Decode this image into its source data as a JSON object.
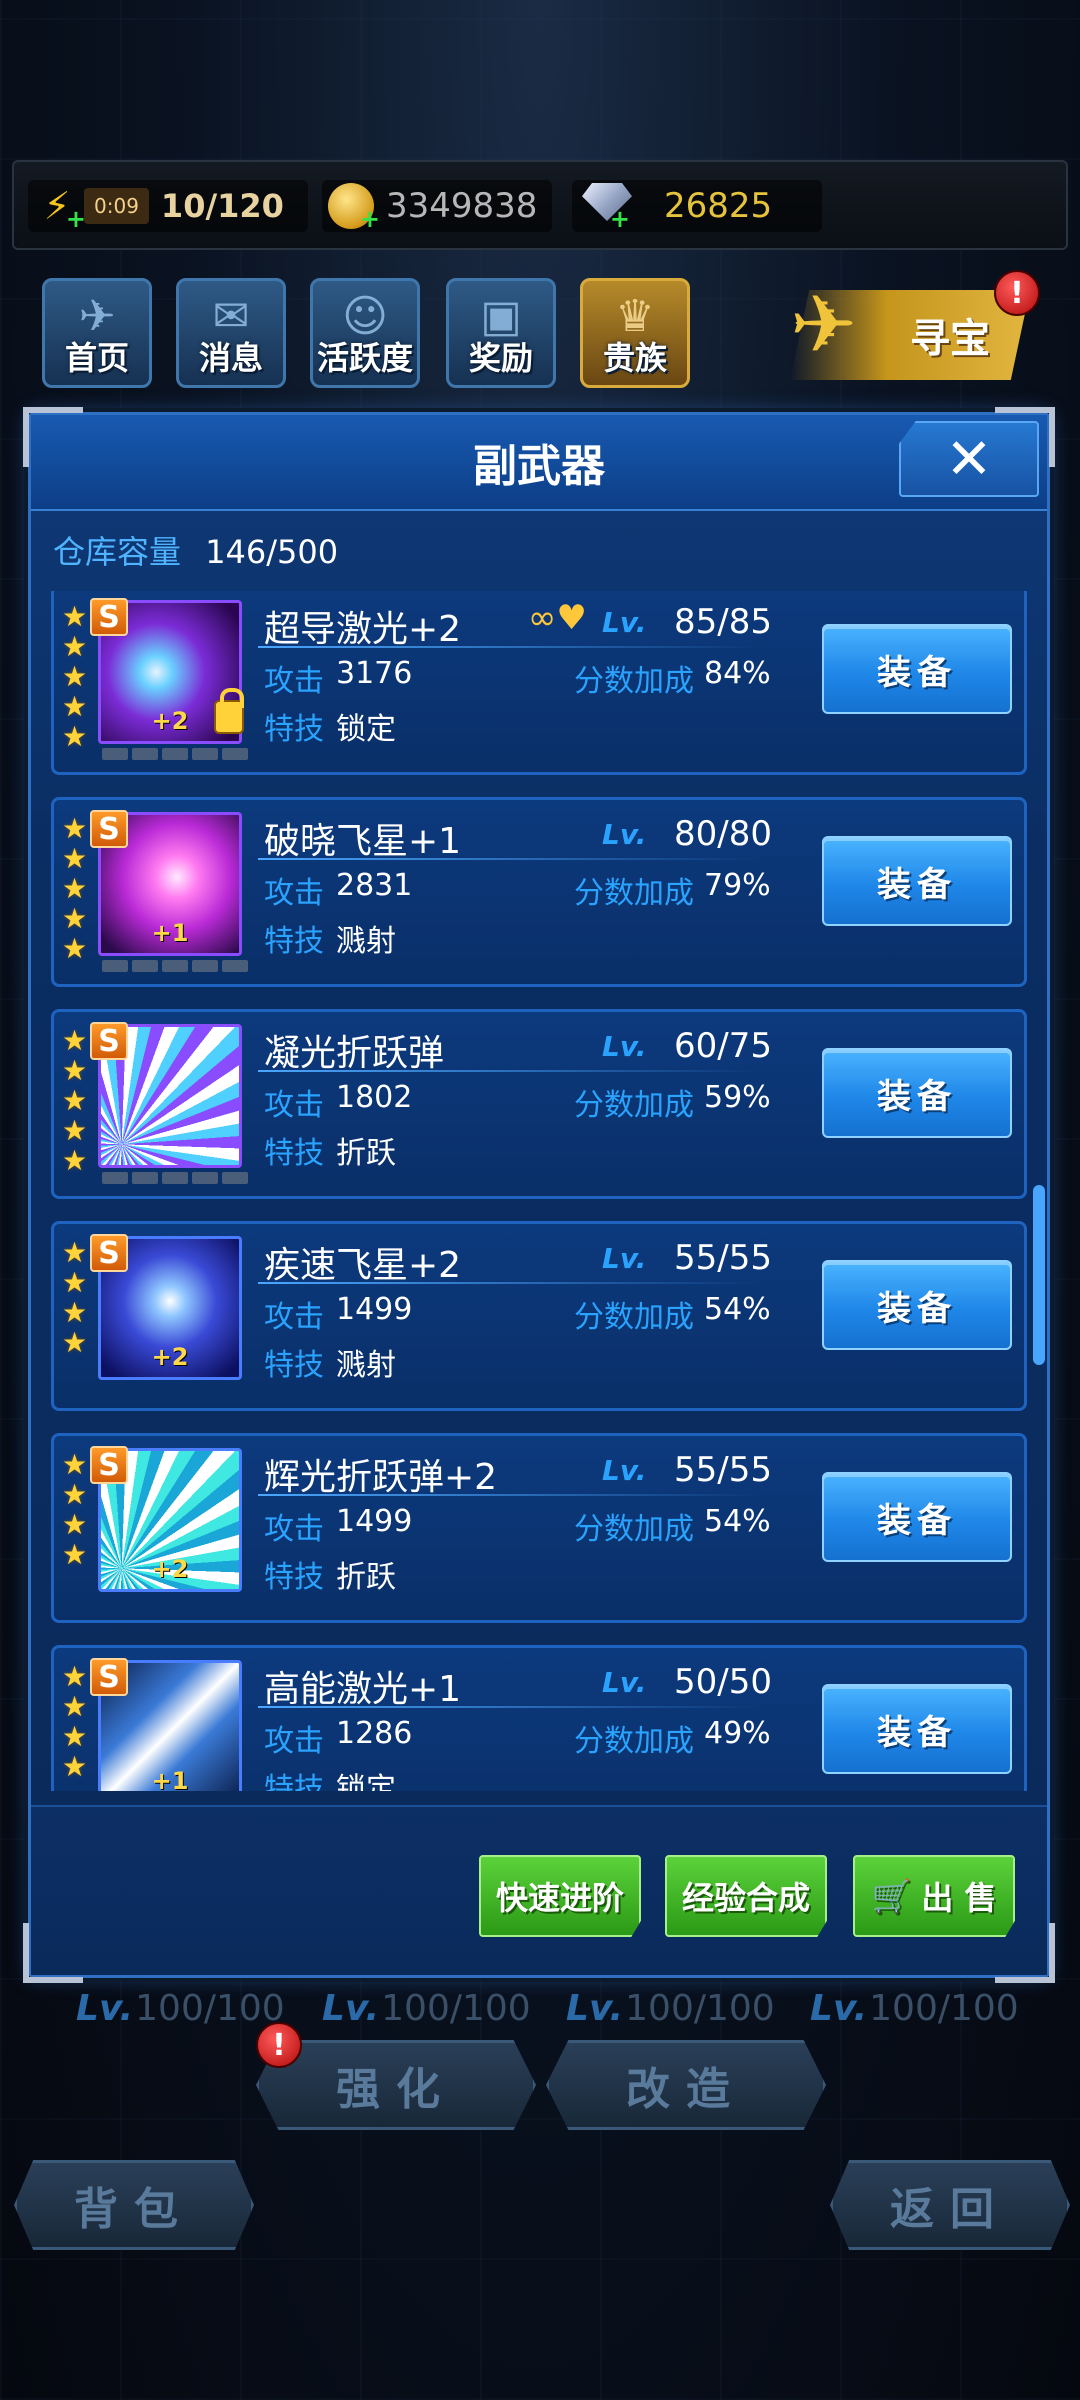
{
  "resources": {
    "timer": "0:09",
    "energy": "10/120",
    "coins": "3349838",
    "gems": "26825"
  },
  "nav": {
    "items": [
      {
        "label": "首页"
      },
      {
        "label": "消息"
      },
      {
        "label": "活跃度"
      },
      {
        "label": "奖励"
      },
      {
        "label": "贵族"
      }
    ],
    "treasure": "寻宝",
    "alert": "!"
  },
  "modal": {
    "title": "副武器",
    "close": "✕",
    "capacity_label": "仓库容量",
    "capacity_value": "146/500",
    "items": [
      {
        "name": "超导激光+2",
        "lv_label": "Lv.",
        "level": "85/85",
        "atk_label": "攻击",
        "atk": "3176",
        "bonus_label": "分数加成",
        "bonus": "84%",
        "skill_label": "特技",
        "skill": "锁定",
        "equip": "装备",
        "grade": "S",
        "plus": "+2",
        "stars": 5
      },
      {
        "name": "破晓飞星+1",
        "lv_label": "Lv.",
        "level": "80/80",
        "atk_label": "攻击",
        "atk": "2831",
        "bonus_label": "分数加成",
        "bonus": "79%",
        "skill_label": "特技",
        "skill": "溅射",
        "equip": "装备",
        "grade": "S",
        "plus": "+1",
        "stars": 5
      },
      {
        "name": "凝光折跃弹",
        "lv_label": "Lv.",
        "level": "60/75",
        "atk_label": "攻击",
        "atk": "1802",
        "bonus_label": "分数加成",
        "bonus": "59%",
        "skill_label": "特技",
        "skill": "折跃",
        "equip": "装备",
        "grade": "S",
        "plus": "",
        "stars": 5
      },
      {
        "name": "疾速飞星+2",
        "lv_label": "Lv.",
        "level": "55/55",
        "atk_label": "攻击",
        "atk": "1499",
        "bonus_label": "分数加成",
        "bonus": "54%",
        "skill_label": "特技",
        "skill": "溅射",
        "equip": "装备",
        "grade": "S",
        "plus": "+2",
        "stars": 4
      },
      {
        "name": "辉光折跃弹+2",
        "lv_label": "Lv.",
        "level": "55/55",
        "atk_label": "攻击",
        "atk": "1499",
        "bonus_label": "分数加成",
        "bonus": "54%",
        "skill_label": "特技",
        "skill": "折跃",
        "equip": "装备",
        "grade": "S",
        "plus": "+2",
        "stars": 4
      },
      {
        "name": "高能激光+1",
        "lv_label": "Lv.",
        "level": "50/50",
        "atk_label": "攻击",
        "atk": "1286",
        "bonus_label": "分数加成",
        "bonus": "49%",
        "skill_label": "特技",
        "skill": "锁定",
        "equip": "装备",
        "grade": "S",
        "plus": "+1",
        "stars": 4
      }
    ],
    "footer": {
      "quick_advance": "快速进阶",
      "exp_merge": "经验合成",
      "sell": "出 售"
    }
  },
  "under": {
    "lv_labels": [
      "Lv.",
      "Lv.",
      "Lv.",
      "Lv."
    ],
    "lv_values": [
      "100/100",
      "100/100",
      "100/100",
      "100/100"
    ],
    "strengthen": "强化",
    "modify": "改造",
    "backpack": "背包",
    "back": "返回"
  }
}
